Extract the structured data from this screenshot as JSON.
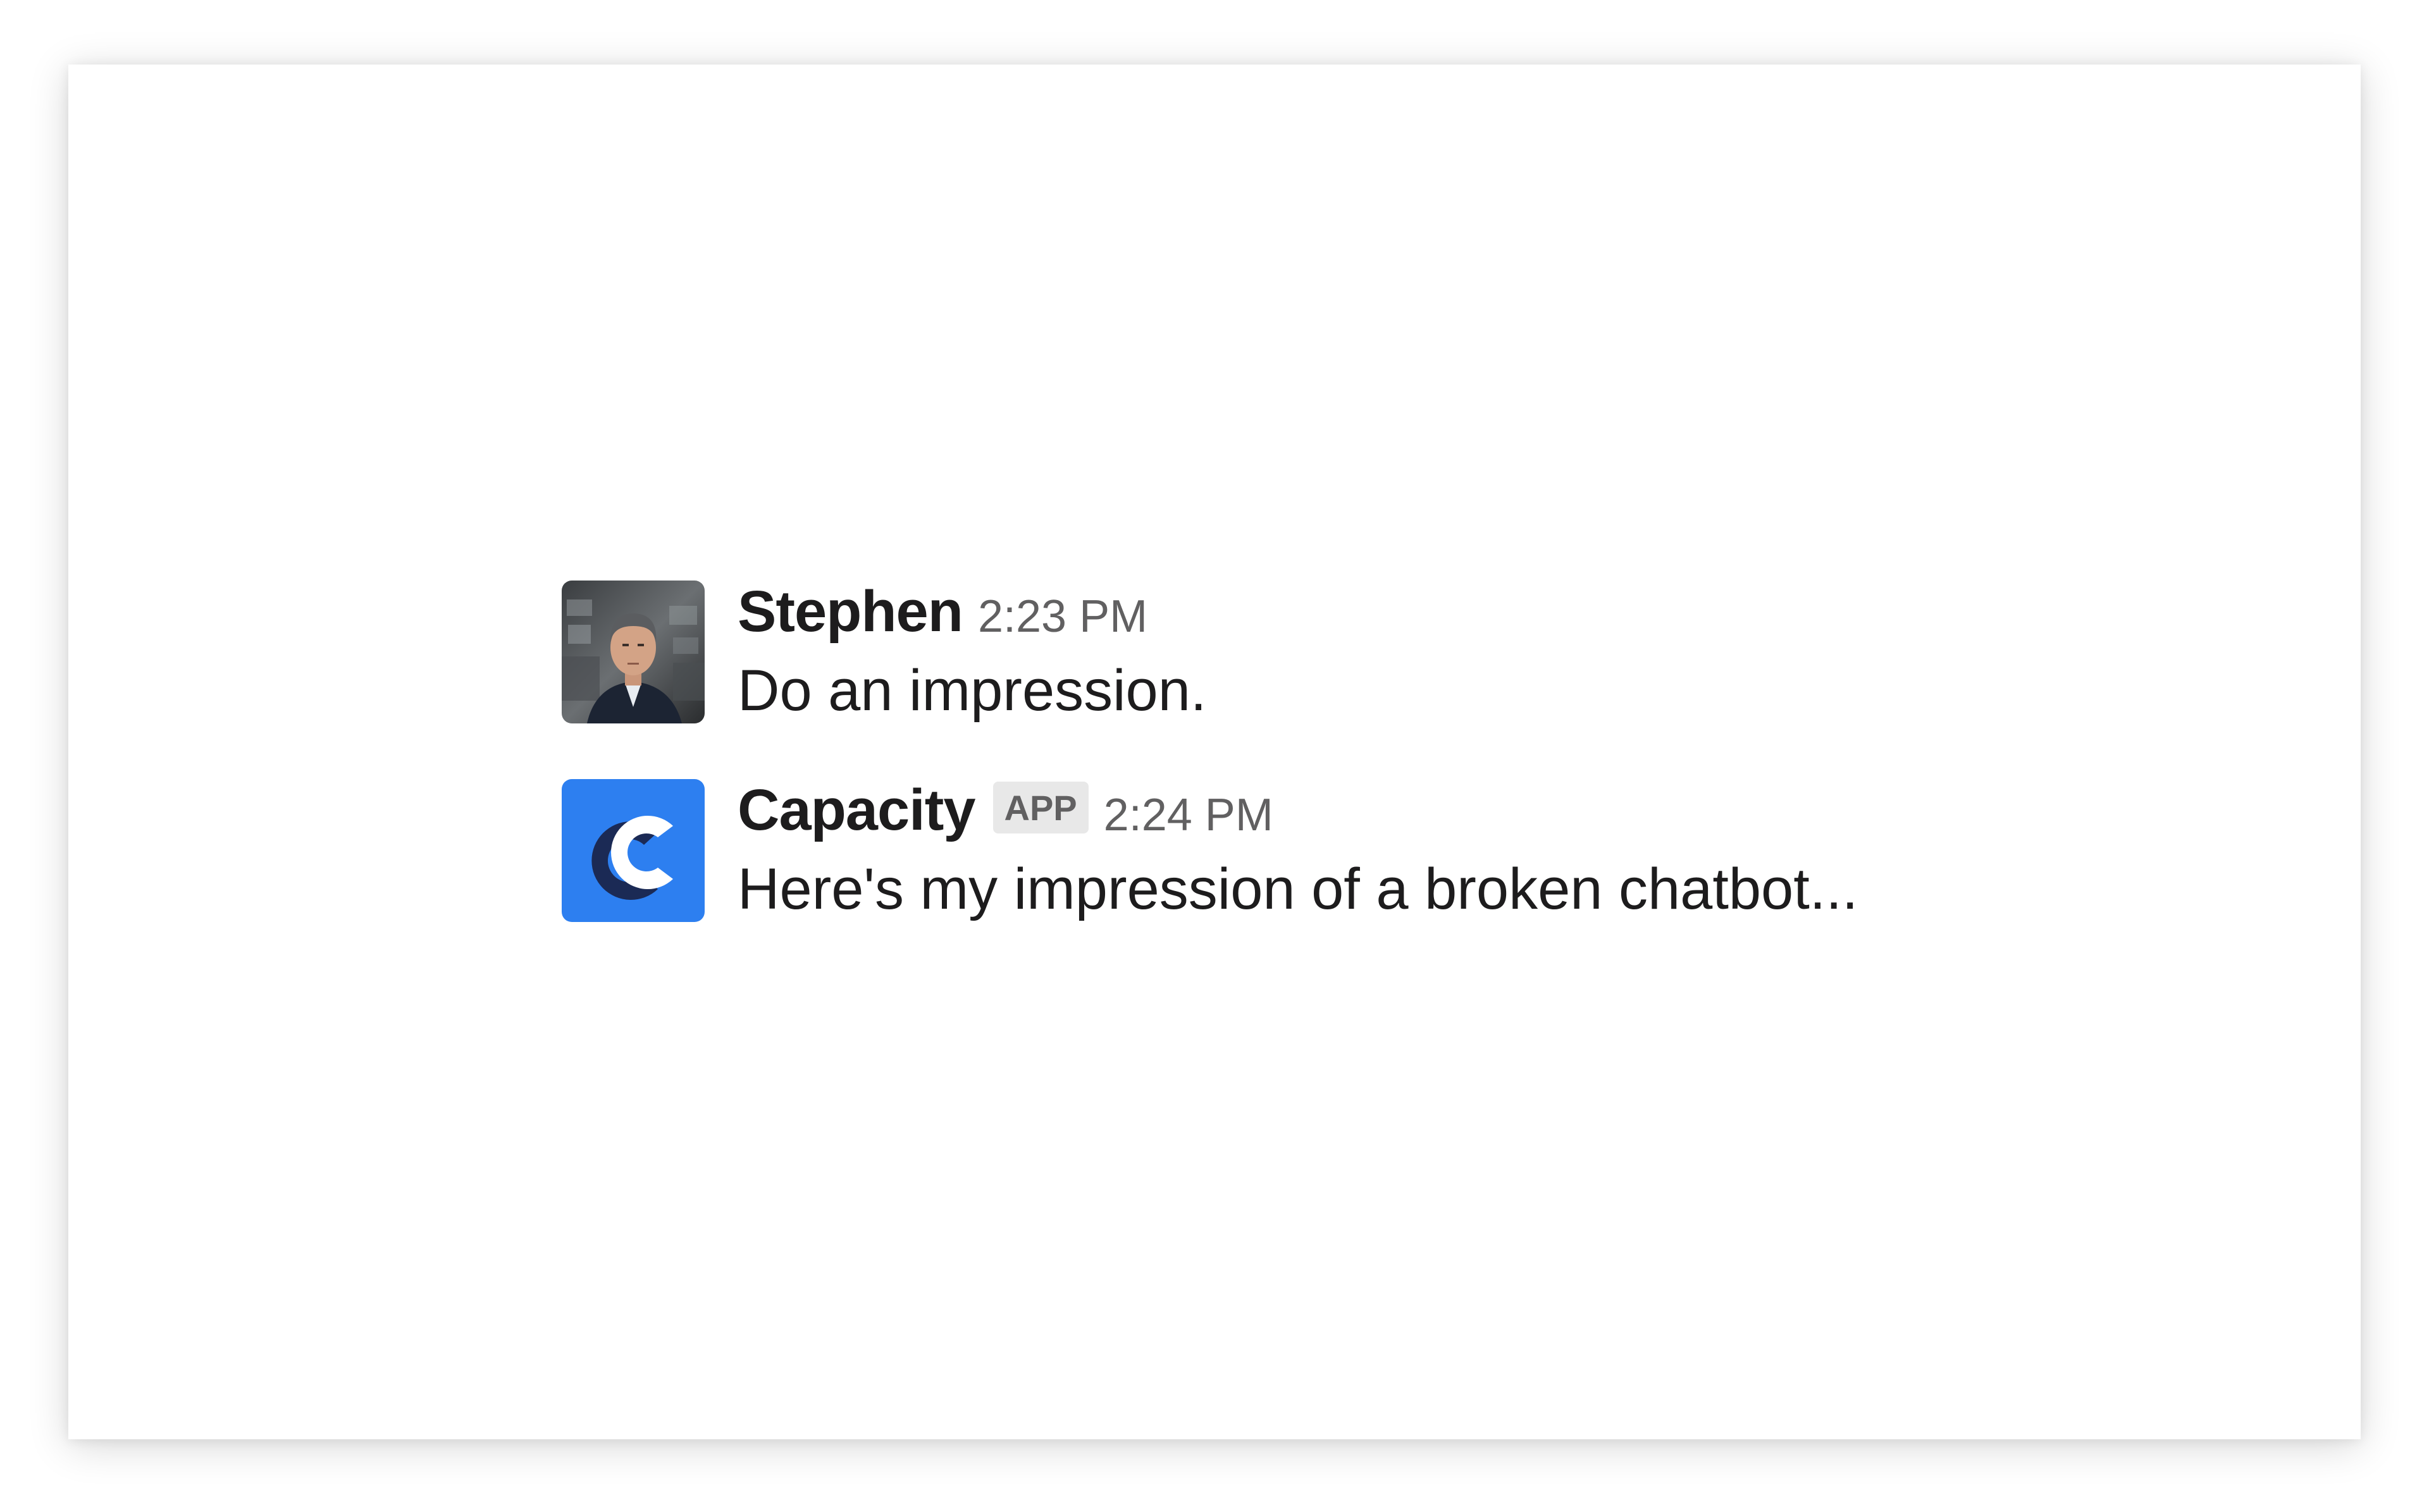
{
  "messages": [
    {
      "sender": "Stephen",
      "timestamp": "2:23 PM",
      "text": "Do an impression.",
      "avatar": "user-photo"
    },
    {
      "sender": "Capacity",
      "badge": "APP",
      "timestamp": "2:24 PM",
      "text": "Here's my impression of a broken chatbot...",
      "avatar": "capacity-logo-icon",
      "avatar_color": "#2d7ff0"
    }
  ]
}
